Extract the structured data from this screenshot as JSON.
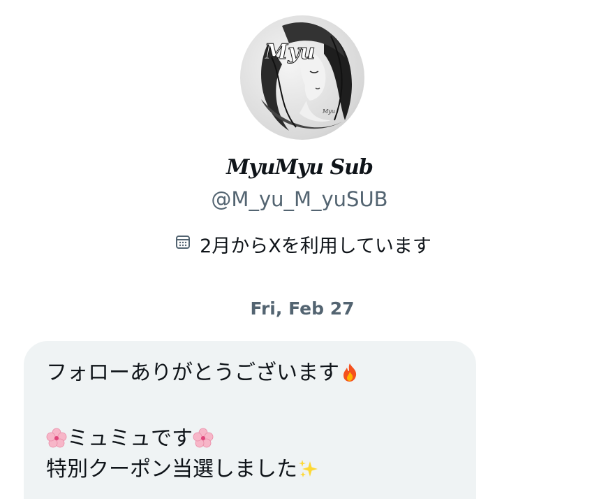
{
  "profile": {
    "display_name": "MyuMyu Sub",
    "handle": "@M_yu_M_yuSUB",
    "joined_text": "2月からXを利用しています",
    "avatar_monogram": "Myu",
    "avatar_signature": "Myu"
  },
  "conversation": {
    "date_separator": "Fri, Feb 27",
    "message": {
      "line1": "フォローありがとうございます",
      "line1_emoji": "fire-emoji",
      "line2": "ミュミュです",
      "line2_emoji": "cherry-blossom-emoji",
      "line3": "特別クーポン当選しました",
      "line3_emoji": "sparkles-emoji"
    }
  },
  "colors": {
    "text_primary": "#0f1419",
    "text_secondary": "#536471",
    "bubble_bg": "#eff3f4",
    "fire": "#f4511e",
    "cherry_blossom": "#f7b6c8"
  }
}
